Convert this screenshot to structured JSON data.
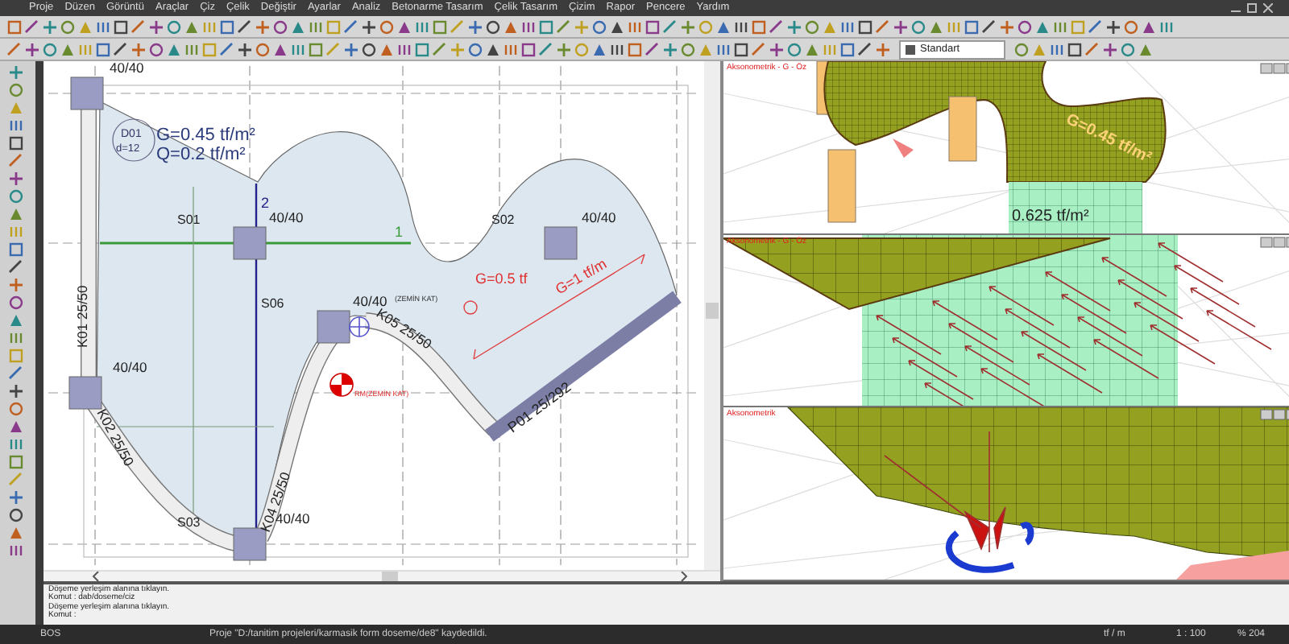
{
  "menu": [
    "Proje",
    "Düzen",
    "Görüntü",
    "Araçlar",
    "Çiz",
    "Çelik",
    "Değiştir",
    "Ayarlar",
    "Analiz",
    "Betonarme Tasarım",
    "Çelik Tasarım",
    "Çizim",
    "Rapor",
    "Pencere",
    "Yardım"
  ],
  "toolbar": {
    "style_select": "Standart"
  },
  "plan": {
    "columns": [
      {
        "label": "40/40"
      },
      {
        "label": "40/40"
      },
      {
        "label": "40/40"
      },
      {
        "label": "40/40"
      },
      {
        "label": "40/40"
      },
      {
        "label": "40/40"
      }
    ],
    "slab": {
      "name": "D01",
      "thickness": "d=12",
      "dead_load": "G=0.45 tf/m²",
      "live_load": "Q=0.2 tf/m²"
    },
    "spans": [
      "S01",
      "S02",
      "S06",
      "S03"
    ],
    "axis_marks": [
      "1",
      "2"
    ],
    "beams": [
      "K01 25/50",
      "K02 25/50",
      "K04 25/50",
      "K05 25/50"
    ],
    "wall": "P01 25/292",
    "loads": [
      "G=0.5 tf",
      "G=1 tf/m"
    ],
    "notes": [
      "(ZEMİN KAT)",
      "RM(ZEMİN KAT)"
    ]
  },
  "views": [
    {
      "kind": "slab-mesh",
      "label": "Aksonometrik - G - Öz",
      "load_labels": [
        "G=0.45 tf/m²",
        "0.625 tf/m²"
      ]
    },
    {
      "kind": "wall-loads",
      "label": "Aksonometrik - G - Öz"
    },
    {
      "kind": "point-load",
      "label": "Aksonometrik"
    }
  ],
  "command_log": [
    "Döşeme yerleşim alanına tıklayın.",
    "Komut : dab/doseme/ciz",
    "Döşeme yerleşim alanına tıklayın.",
    "Komut :"
  ],
  "status_bar": [
    "BOS",
    "Proje \"D:/tanitim projeleri/karmasik form doseme/de8\" kaydedildi.",
    "tf / m",
    "1 : 100",
    "% 204"
  ]
}
